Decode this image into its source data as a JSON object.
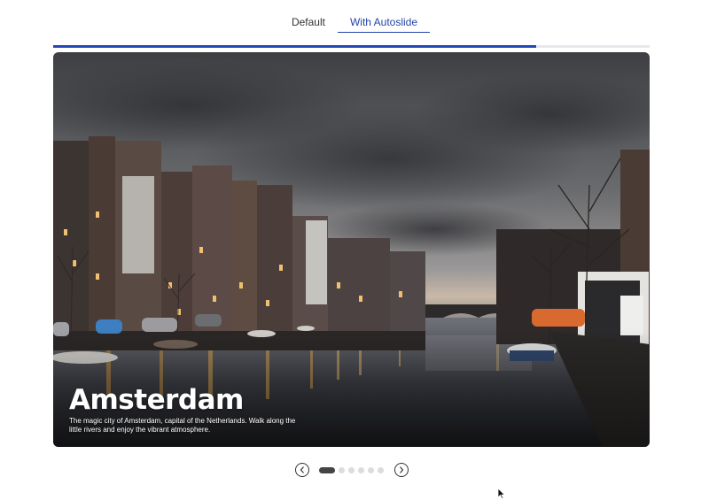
{
  "tabs": [
    {
      "label": "Default",
      "active": false
    },
    {
      "label": "With Autoslide",
      "active": true
    }
  ],
  "autoslide_progress": 0.81,
  "slide": {
    "title": "Amsterdam",
    "description": "The magic city of Amsterdam, capital of the Netherlands. Walk along the little rivers and enjoy the vibrant atmosphere.",
    "image": "amsterdam-canal-photo"
  },
  "pagination": {
    "total": 6,
    "current": 1,
    "prev_icon": "chevron-left-icon",
    "next_icon": "chevron-right-icon"
  },
  "colors": {
    "accent": "#2448b8",
    "active_dot": "#444444",
    "inactive_dot": "#dcdcdc"
  }
}
